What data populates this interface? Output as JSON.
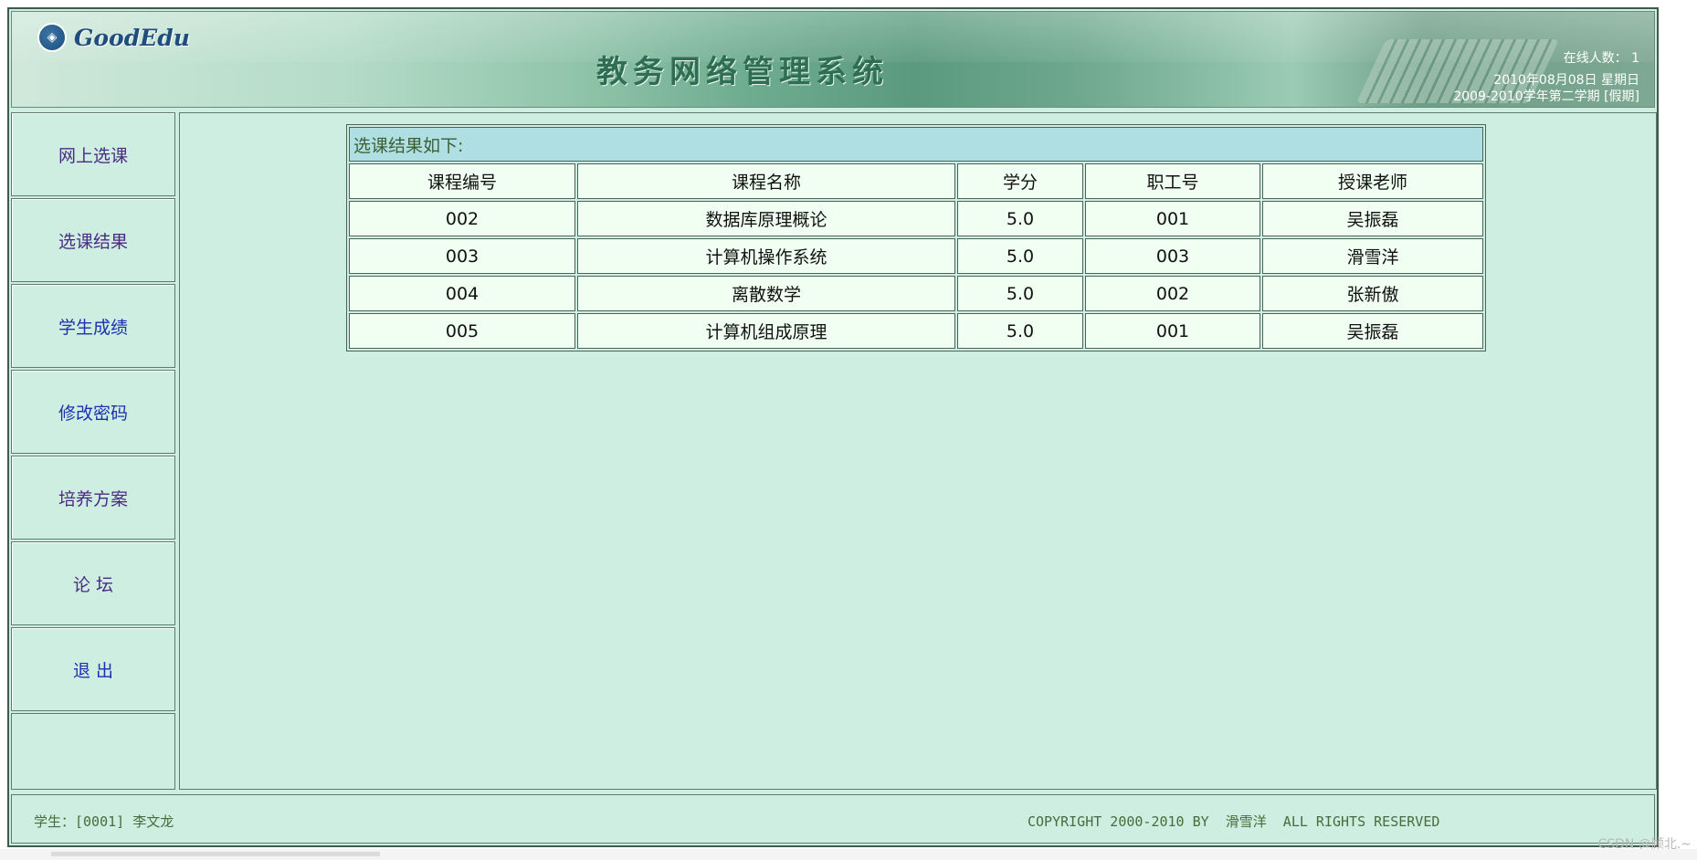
{
  "header": {
    "logo_text": "GoodEdu",
    "system_title": "教务网络管理系统",
    "online_users": "在线人数： 1",
    "date": "2010年08月08日  星期日",
    "term": "2009-2010学年第二学期 [假期]"
  },
  "sidebar": {
    "items": [
      {
        "label": "网上选课"
      },
      {
        "label": "选课结果"
      },
      {
        "label": "学生成绩"
      },
      {
        "label": "修改密码"
      },
      {
        "label": "培养方案"
      },
      {
        "label": "论 坛"
      },
      {
        "label": "退 出"
      }
    ]
  },
  "result": {
    "caption": "选课结果如下:",
    "columns": [
      "课程编号",
      "课程名称",
      "学分",
      "职工号",
      "授课老师"
    ],
    "rows": [
      [
        "002",
        "数据库原理概论",
        "5.0",
        "001",
        "吴振磊"
      ],
      [
        "003",
        "计算机操作系统",
        "5.0",
        "003",
        "滑雪洋"
      ],
      [
        "004",
        "离散数学",
        "5.0",
        "002",
        "张新傲"
      ],
      [
        "005",
        "计算机组成原理",
        "5.0",
        "001",
        "吴振磊"
      ]
    ]
  },
  "footer": {
    "student": "学生：[0001] 李文龙",
    "copyright": "COPYRIGHT 2000-2010 BY  滑雪洋  ALL RIGHTS RESERVED"
  },
  "watermark": "CSDN @顾北.~",
  "colors": {
    "background": "#cdeee0",
    "caption_bg": "#b0dfe3",
    "cell_bg": "#f0fff2",
    "nav_purple": "#4b2b82",
    "nav_blue": "#1f2fb0"
  }
}
